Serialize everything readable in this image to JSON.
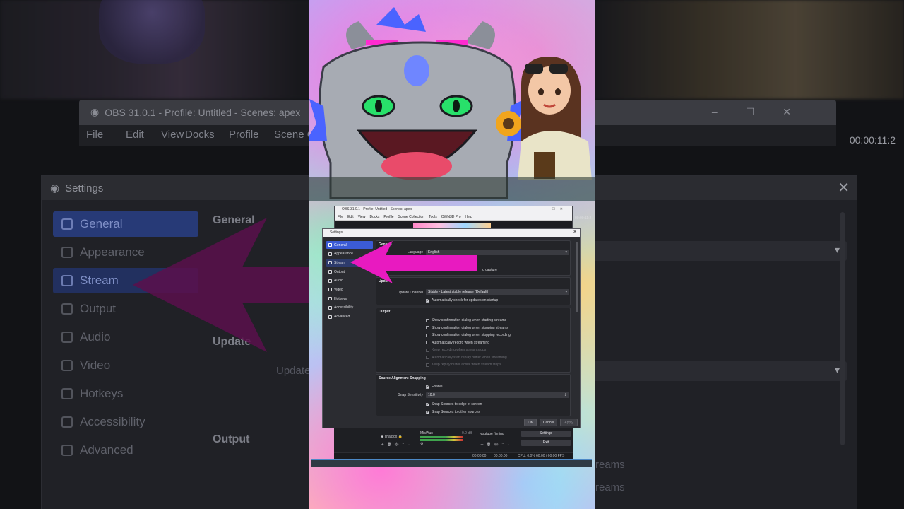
{
  "background": {
    "obs_title": "OBS 31.0.1 - Profile: Untitled - Scenes: apex",
    "menu": [
      "File",
      "Edit",
      "View",
      "Docks",
      "Profile",
      "Scene C"
    ],
    "timer": "00:00:11:2",
    "settings_title": "Settings",
    "sidebar": [
      {
        "label": "General",
        "icon": "gear-icon"
      },
      {
        "label": "Appearance",
        "icon": "appearance-icon"
      },
      {
        "label": "Stream",
        "icon": "stream-icon"
      },
      {
        "label": "Output",
        "icon": "output-icon"
      },
      {
        "label": "Audio",
        "icon": "speaker-icon"
      },
      {
        "label": "Video",
        "icon": "monitor-icon"
      },
      {
        "label": "Hotkeys",
        "icon": "keyboard-icon"
      },
      {
        "label": "Accessibility",
        "icon": "accessibility-icon"
      },
      {
        "label": "Advanced",
        "icon": "wrench-icon"
      }
    ],
    "sections": {
      "general": "General",
      "updates": "Update",
      "updates_row": "Update",
      "output": "Output"
    },
    "right_texts": [
      "reams",
      "reams"
    ]
  },
  "obs": {
    "title": "OBS 31.0.1 - Profile: Untitled - Scenes: apex",
    "menu": [
      "File",
      "Edit",
      "View",
      "Docks",
      "Profile",
      "Scene Collection",
      "Tools",
      "OWN3D Pro",
      "Help"
    ],
    "timer": "00:00:11:2"
  },
  "settings": {
    "title": "Settings",
    "sidebar": [
      {
        "label": "General",
        "selected": true
      },
      {
        "label": "Appearance",
        "selected": false
      },
      {
        "label": "Stream",
        "selected": false
      },
      {
        "label": "Output",
        "selected": false
      },
      {
        "label": "Audio",
        "selected": false
      },
      {
        "label": "Video",
        "selected": false
      },
      {
        "label": "Hotkeys",
        "selected": false
      },
      {
        "label": "Accessibility",
        "selected": false
      },
      {
        "label": "Advanced",
        "selected": false
      }
    ],
    "general": {
      "heading": "General",
      "language_label": "Language",
      "language_value": "English",
      "capture_text": "o capture"
    },
    "updates": {
      "heading": "Upda",
      "channel_label": "Update Channel",
      "channel_value": "Stable - Latest stable release (Default)",
      "auto_check": "Automatically check for updates on startup"
    },
    "output": {
      "heading": "Output",
      "options": [
        {
          "label": "Show confirmation dialog when starting streams",
          "checked": false,
          "enabled": true
        },
        {
          "label": "Show confirmation dialog when stopping streams",
          "checked": false,
          "enabled": true
        },
        {
          "label": "Show confirmation dialog when stopping recording",
          "checked": false,
          "enabled": true
        },
        {
          "label": "Automatically record when streaming",
          "checked": false,
          "enabled": true
        },
        {
          "label": "Keep recording when stream stops",
          "checked": false,
          "enabled": false
        },
        {
          "label": "Automatically start replay buffer when streaming",
          "checked": false,
          "enabled": false
        },
        {
          "label": "Keep replay buffer active when stream stops",
          "checked": false,
          "enabled": false
        }
      ]
    },
    "snapping": {
      "heading": "Source Alignment Snapping",
      "enable": "Enable",
      "sensitivity_label": "Snap Sensitivity",
      "sensitivity_value": "10.0",
      "edge": "Snap Sources to edge of screen",
      "other": "Snap Sources to other sources"
    },
    "buttons": {
      "ok": "OK",
      "cancel": "Cancel",
      "apply": "Apply"
    }
  },
  "bottom": {
    "source": "chatbox",
    "mixer": "Mic/Aux",
    "mixer_db": "0.0 dB",
    "transition": "youtube filming",
    "settings_btn": "Settings",
    "exit_btn": "Exit",
    "status": [
      "00:00:00",
      "00:00:00",
      "CPU: 0.0%",
      "60.00 / 60.00 FPS"
    ]
  },
  "colors": {
    "accent": "#3b5bd6",
    "arrow": "#e81ac0"
  }
}
